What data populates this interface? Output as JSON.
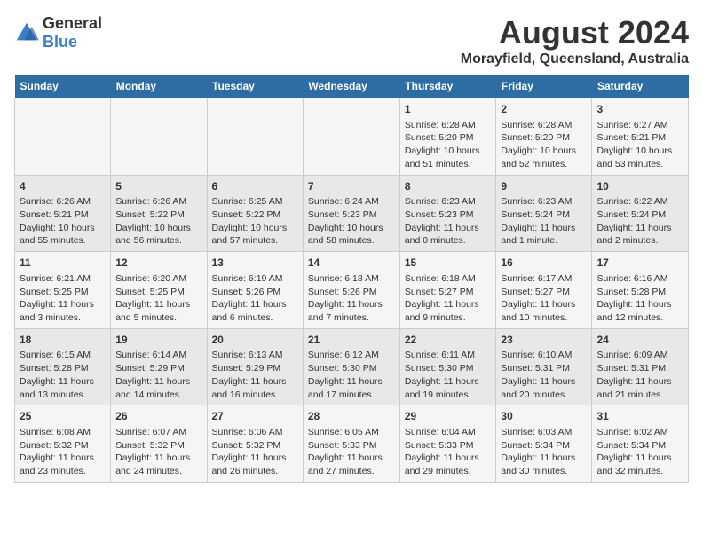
{
  "logo": {
    "general": "General",
    "blue": "Blue"
  },
  "title": "August 2024",
  "subtitle": "Morayfield, Queensland, Australia",
  "days_header": [
    "Sunday",
    "Monday",
    "Tuesday",
    "Wednesday",
    "Thursday",
    "Friday",
    "Saturday"
  ],
  "weeks": [
    [
      {
        "day": "",
        "info": ""
      },
      {
        "day": "",
        "info": ""
      },
      {
        "day": "",
        "info": ""
      },
      {
        "day": "",
        "info": ""
      },
      {
        "day": "1",
        "info": "Sunrise: 6:28 AM\nSunset: 5:20 PM\nDaylight: 10 hours and 51 minutes."
      },
      {
        "day": "2",
        "info": "Sunrise: 6:28 AM\nSunset: 5:20 PM\nDaylight: 10 hours and 52 minutes."
      },
      {
        "day": "3",
        "info": "Sunrise: 6:27 AM\nSunset: 5:21 PM\nDaylight: 10 hours and 53 minutes."
      }
    ],
    [
      {
        "day": "4",
        "info": "Sunrise: 6:26 AM\nSunset: 5:21 PM\nDaylight: 10 hours and 55 minutes."
      },
      {
        "day": "5",
        "info": "Sunrise: 6:26 AM\nSunset: 5:22 PM\nDaylight: 10 hours and 56 minutes."
      },
      {
        "day": "6",
        "info": "Sunrise: 6:25 AM\nSunset: 5:22 PM\nDaylight: 10 hours and 57 minutes."
      },
      {
        "day": "7",
        "info": "Sunrise: 6:24 AM\nSunset: 5:23 PM\nDaylight: 10 hours and 58 minutes."
      },
      {
        "day": "8",
        "info": "Sunrise: 6:23 AM\nSunset: 5:23 PM\nDaylight: 11 hours and 0 minutes."
      },
      {
        "day": "9",
        "info": "Sunrise: 6:23 AM\nSunset: 5:24 PM\nDaylight: 11 hours and 1 minute."
      },
      {
        "day": "10",
        "info": "Sunrise: 6:22 AM\nSunset: 5:24 PM\nDaylight: 11 hours and 2 minutes."
      }
    ],
    [
      {
        "day": "11",
        "info": "Sunrise: 6:21 AM\nSunset: 5:25 PM\nDaylight: 11 hours and 3 minutes."
      },
      {
        "day": "12",
        "info": "Sunrise: 6:20 AM\nSunset: 5:25 PM\nDaylight: 11 hours and 5 minutes."
      },
      {
        "day": "13",
        "info": "Sunrise: 6:19 AM\nSunset: 5:26 PM\nDaylight: 11 hours and 6 minutes."
      },
      {
        "day": "14",
        "info": "Sunrise: 6:18 AM\nSunset: 5:26 PM\nDaylight: 11 hours and 7 minutes."
      },
      {
        "day": "15",
        "info": "Sunrise: 6:18 AM\nSunset: 5:27 PM\nDaylight: 11 hours and 9 minutes."
      },
      {
        "day": "16",
        "info": "Sunrise: 6:17 AM\nSunset: 5:27 PM\nDaylight: 11 hours and 10 minutes."
      },
      {
        "day": "17",
        "info": "Sunrise: 6:16 AM\nSunset: 5:28 PM\nDaylight: 11 hours and 12 minutes."
      }
    ],
    [
      {
        "day": "18",
        "info": "Sunrise: 6:15 AM\nSunset: 5:28 PM\nDaylight: 11 hours and 13 minutes."
      },
      {
        "day": "19",
        "info": "Sunrise: 6:14 AM\nSunset: 5:29 PM\nDaylight: 11 hours and 14 minutes."
      },
      {
        "day": "20",
        "info": "Sunrise: 6:13 AM\nSunset: 5:29 PM\nDaylight: 11 hours and 16 minutes."
      },
      {
        "day": "21",
        "info": "Sunrise: 6:12 AM\nSunset: 5:30 PM\nDaylight: 11 hours and 17 minutes."
      },
      {
        "day": "22",
        "info": "Sunrise: 6:11 AM\nSunset: 5:30 PM\nDaylight: 11 hours and 19 minutes."
      },
      {
        "day": "23",
        "info": "Sunrise: 6:10 AM\nSunset: 5:31 PM\nDaylight: 11 hours and 20 minutes."
      },
      {
        "day": "24",
        "info": "Sunrise: 6:09 AM\nSunset: 5:31 PM\nDaylight: 11 hours and 21 minutes."
      }
    ],
    [
      {
        "day": "25",
        "info": "Sunrise: 6:08 AM\nSunset: 5:32 PM\nDaylight: 11 hours and 23 minutes."
      },
      {
        "day": "26",
        "info": "Sunrise: 6:07 AM\nSunset: 5:32 PM\nDaylight: 11 hours and 24 minutes."
      },
      {
        "day": "27",
        "info": "Sunrise: 6:06 AM\nSunset: 5:32 PM\nDaylight: 11 hours and 26 minutes."
      },
      {
        "day": "28",
        "info": "Sunrise: 6:05 AM\nSunset: 5:33 PM\nDaylight: 11 hours and 27 minutes."
      },
      {
        "day": "29",
        "info": "Sunrise: 6:04 AM\nSunset: 5:33 PM\nDaylight: 11 hours and 29 minutes."
      },
      {
        "day": "30",
        "info": "Sunrise: 6:03 AM\nSunset: 5:34 PM\nDaylight: 11 hours and 30 minutes."
      },
      {
        "day": "31",
        "info": "Sunrise: 6:02 AM\nSunset: 5:34 PM\nDaylight: 11 hours and 32 minutes."
      }
    ]
  ]
}
